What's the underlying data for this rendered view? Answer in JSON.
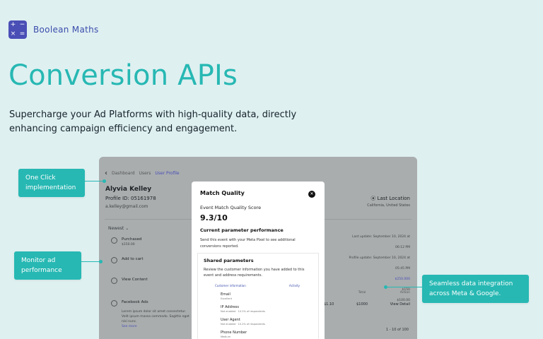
{
  "brand": {
    "logo_symbols": [
      "+",
      "−",
      "×",
      "="
    ],
    "name": "Boolean Maths",
    "color": "#4a4fb6"
  },
  "hero": {
    "title": "Conversion APIs",
    "subtitle": "Supercharge your Ad Platforms with high-quality data, directly enhancing campaign efficiency and engagement.",
    "accent_color": "#27b8b3"
  },
  "dashboard": {
    "breadcrumbs": [
      "Dashboard",
      "Users",
      "User Profile"
    ],
    "user": {
      "name": "Alyvia Kelley",
      "profile_id": "Profile ID: 05161978",
      "email": "a.kelley@gmail.com"
    },
    "location": {
      "label": "Last Location",
      "value": "California, United States"
    },
    "sort_label": "Newest",
    "events": [
      {
        "title": "Purchased",
        "sub": "$150.00"
      },
      {
        "title": "Add to cart",
        "sub": ""
      },
      {
        "title": "View Content",
        "sub": ""
      },
      {
        "title": "Facebook Ads",
        "sub": ""
      }
    ],
    "ads_description": "Lorem ipsum dolor sit amet consectetur. Velit ipsum massa commodo. Sagittis eget nisi nunc.",
    "ads_link": "See more",
    "right_panel": {
      "lines": [
        "Last update: September 10, 2024 at 06:12 PM",
        "Profile update: September 10, 2024 at 05:45 PM",
        "$250.000",
        "$150",
        "$100.00"
      ]
    },
    "table": {
      "headers": [
        "",
        "Total",
        "Action"
      ],
      "row": [
        "$1.10",
        "$1000",
        "View Detail"
      ]
    },
    "footer": "1 - 10 of 100"
  },
  "modal": {
    "title": "Match Quality",
    "score_label": "Event Match Quality Score",
    "score": "9.3/10",
    "current_heading": "Current parameter performance",
    "current_desc": "Send this event with your Meta Pixel to see additional conversions reported.",
    "shared_heading": "Shared parameters",
    "shared_desc": "Review the customer information you have added to this event and address requirements.",
    "columns": [
      "Customer information",
      "Activity"
    ],
    "params": [
      {
        "name": "Email",
        "sub": "Excellent"
      },
      {
        "name": "IP Address",
        "sub": "Not enabled · 10.2% of respondents"
      },
      {
        "name": "User Agent",
        "sub": "Not enabled · 10.2% of respondents"
      },
      {
        "name": "Phone Number",
        "sub": "Medium"
      }
    ]
  },
  "callouts": {
    "one_click": "One Click implementation",
    "monitor": "Monitor ad performance",
    "seamless": "Seamless data integration across Meta & Google."
  }
}
